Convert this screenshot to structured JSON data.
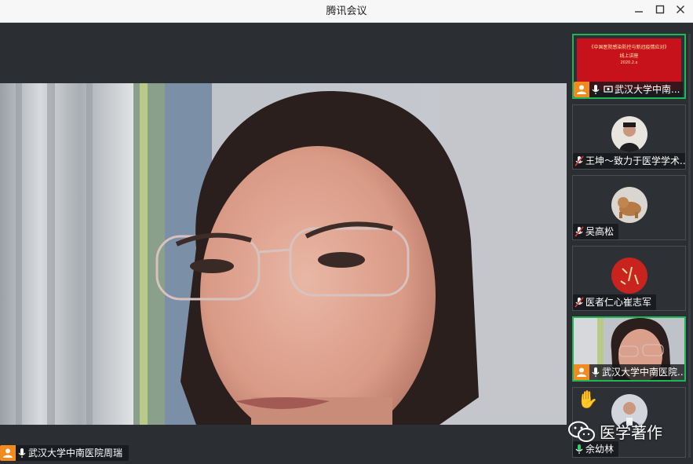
{
  "window": {
    "title": "腾讯会议",
    "minimize_symbol": "—",
    "maximize_symbol": "☐",
    "close_symbol": "✕"
  },
  "main_video": {
    "speaker_name": "武汉大学中南医院周瑞",
    "avatar_icon": "person-icon",
    "mic_icon": "microphone-icon"
  },
  "participants": [
    {
      "name": "武汉大学中南...",
      "type": "screen-share",
      "active": true,
      "mic": "on",
      "slide_title": "《中国医院感染防控与新冠疫情应对》",
      "slide_sub": "线上讲座",
      "slide_date": "2020.2.x"
    },
    {
      "name": "王坤～致力于医学学术...",
      "type": "avatar",
      "active": false,
      "mic": "muted"
    },
    {
      "name": "吴高松",
      "type": "avatar",
      "active": false,
      "mic": "muted"
    },
    {
      "name": "医者仁心崔志军",
      "type": "avatar",
      "active": false,
      "mic": "muted"
    },
    {
      "name": "武汉大学中南医院...",
      "type": "video",
      "active": true,
      "mic": "on"
    },
    {
      "name": "余幼林",
      "type": "avatar",
      "active": false,
      "mic": "on"
    }
  ],
  "raise_hand_icon": "raised-hand-icon",
  "watermark": {
    "text": "医学著作",
    "icon": "wechat-icon"
  },
  "colors": {
    "accent_active": "#1fb755",
    "avatar_badge": "#f28b1f",
    "background": "#2b2e33"
  }
}
